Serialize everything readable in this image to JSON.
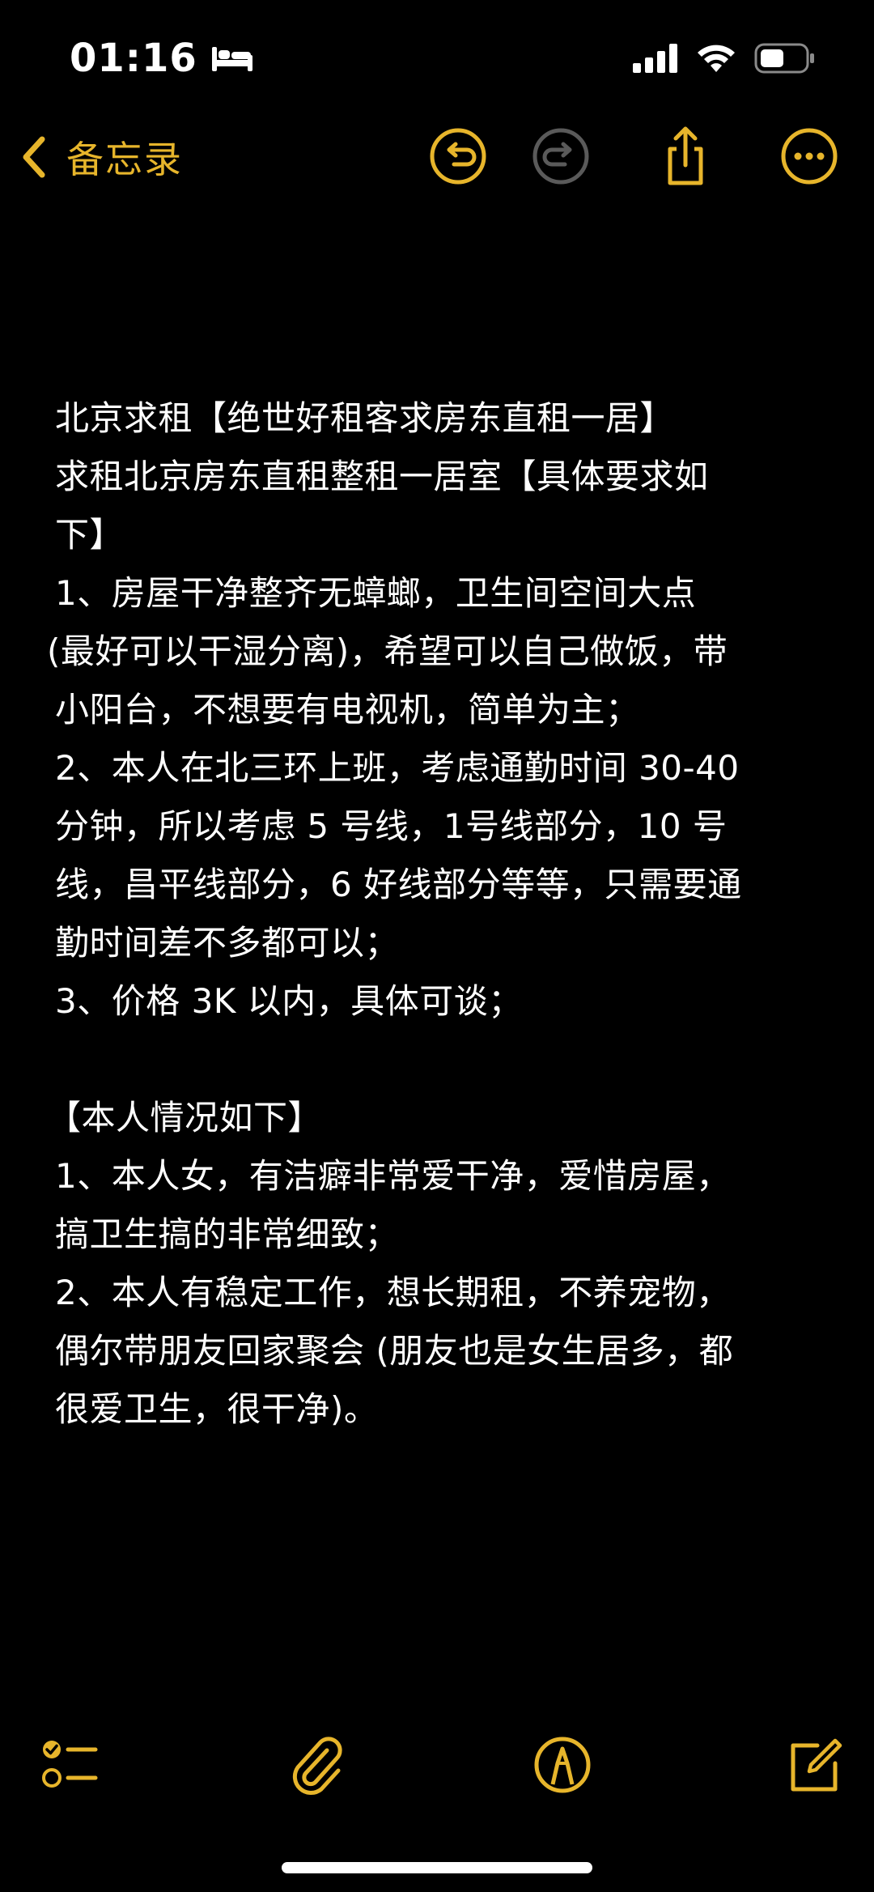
{
  "status_bar": {
    "time": "01:16",
    "sleep_icon": "bed-icon",
    "signal_icon": "cellular-signal-icon",
    "wifi_icon": "wifi-icon",
    "battery_icon": "battery-icon"
  },
  "nav": {
    "back_label": "备忘录",
    "back_icon": "chevron-left-icon",
    "undo_icon": "undo-icon",
    "redo_icon": "redo-icon",
    "share_icon": "share-icon",
    "more_icon": "more-icon"
  },
  "note": {
    "lines": [
      "北京求租【绝世好租客求房东直租一居】",
      "求租北京房东直租整租一居室【具体要求如",
      "下】",
      "1、房屋干净整齐无蟑螂，卫生间空间大点",
      "(最好可以干湿分离)，希望可以自己做饭，带",
      "小阳台，不想要有电视机，简单为主；",
      "2、本人在北三环上班，考虑通勤时间 30-40",
      "分钟，所以考虑 5 号线，1号线部分，10 号",
      "线，昌平线部分，6 好线部分等等，只需要通",
      "勤时间差不多都可以；",
      "3、价格 3K 以内，具体可谈；",
      "",
      "【本人情况如下】",
      "1、本人女，有洁癖非常爱干净，爱惜房屋，",
      "搞卫生搞的非常细致；",
      "2、本人有稳定工作，想长期租，不养宠物，",
      "偶尔带朋友回家聚会 (朋友也是女生居多，都",
      "很爱卫生，很干净)。"
    ]
  },
  "toolbar": {
    "checklist_icon": "checklist-icon",
    "attachment_icon": "paperclip-icon",
    "markup_icon": "markup-pen-icon",
    "compose_icon": "compose-icon"
  },
  "colors": {
    "background": "#000000",
    "text": "#ffffff",
    "accent": "#e7b52b",
    "disabled": "#5a5a5a"
  }
}
